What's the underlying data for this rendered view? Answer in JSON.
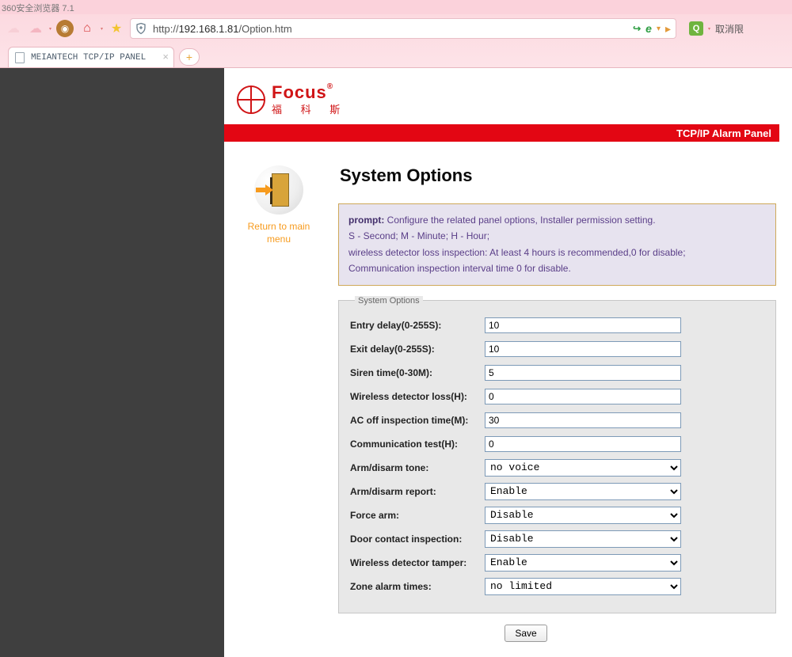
{
  "browser": {
    "title": "360安全浏览器  7.1",
    "url_proto": "http://",
    "url_host": "192.168.1.81",
    "url_path": "/Option.htm",
    "cancel_text": "取消限",
    "tab_title": "MEIANTECH TCP/IP PANEL"
  },
  "logo": {
    "en": "Focus",
    "cn": "福 科 斯"
  },
  "banner": "TCP/IP Alarm Panel",
  "return_link": "Return to main menu",
  "heading": "System Options",
  "prompt": {
    "label": "prompt:",
    "l1": "Configure the related panel options, Installer permission setting.",
    "l2": "S - Second; M - Minute; H - Hour;",
    "l3": "wireless detector loss inspection: At least 4 hours is recommended,0 for disable;",
    "l4": "Communication inspection interval time 0 for disable."
  },
  "fieldset_legend": "System Options",
  "fields": {
    "entry_delay": {
      "label": "Entry delay(0-255S):",
      "value": "10"
    },
    "exit_delay": {
      "label": "Exit delay(0-255S):",
      "value": "10"
    },
    "siren_time": {
      "label": "Siren time(0-30M):",
      "value": "5"
    },
    "wireless_loss": {
      "label": "Wireless detector loss(H):",
      "value": "0"
    },
    "ac_off": {
      "label": "AC off inspection time(M):",
      "value": "30"
    },
    "comm_test": {
      "label": "Communication test(H):",
      "value": "0"
    },
    "arm_tone": {
      "label": "Arm/disarm tone:",
      "value": "no voice"
    },
    "arm_report": {
      "label": "Arm/disarm report:",
      "value": "Enable"
    },
    "force_arm": {
      "label": "Force arm:",
      "value": "Disable"
    },
    "door_contact": {
      "label": "Door contact inspection:",
      "value": "Disable"
    },
    "tamper": {
      "label": "Wireless detector tamper:",
      "value": "Enable"
    },
    "zone_alarm": {
      "label": "Zone alarm times:",
      "value": "no limited"
    }
  },
  "save_label": "Save"
}
